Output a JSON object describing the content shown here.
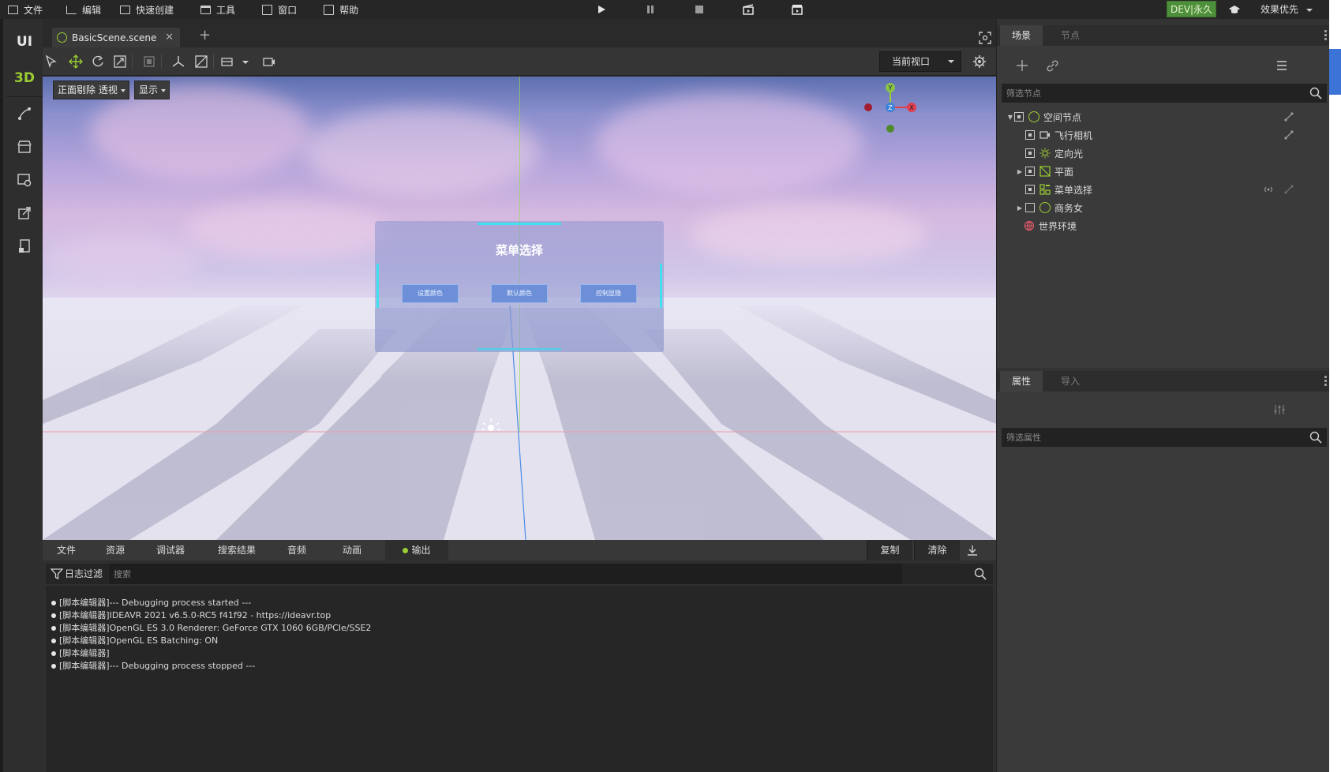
{
  "menubar": {
    "items": [
      {
        "label": "文件",
        "icon": "folder-icon"
      },
      {
        "label": "编辑",
        "icon": "crop-icon"
      },
      {
        "label": "快速创建",
        "icon": "edit-icon"
      },
      {
        "label": "工具",
        "icon": "window-icon"
      },
      {
        "label": "窗口",
        "icon": "frame-icon"
      },
      {
        "label": "帮助",
        "icon": "doc-icon"
      }
    ],
    "controls": [
      "play-icon",
      "pause-icon",
      "stop-icon",
      "clapper-open-icon",
      "clapper-icon"
    ],
    "dev_badge": "DEV|永久",
    "quality": "效果优先"
  },
  "leftrail": {
    "ui_label": "UI",
    "three_d_label": "3D",
    "icons": [
      "path-icon",
      "store-icon",
      "settings-panel-icon",
      "export-icon",
      "book-icon"
    ],
    "colors": {
      "ui": "#e6e6e6",
      "three_d": "#9acd32"
    }
  },
  "editor": {
    "tab_label": "BasicScene.scene",
    "viewport_select": "当前视口",
    "chips": {
      "cull": "正面剔除 透视",
      "display": "显示"
    },
    "scene_menu": {
      "title": "菜单选择",
      "buttons": [
        "设置颜色",
        "默认颜色",
        "控制显隐"
      ]
    },
    "gizmo": {
      "y": "Y",
      "z": "Z",
      "x": "X"
    }
  },
  "bottom": {
    "tabs": [
      "文件",
      "资源",
      "调试器",
      "搜索结果",
      "音频",
      "动画",
      "输出"
    ],
    "active_tab": "输出",
    "copy_label": "复制",
    "clear_label": "清除",
    "log_filter_label": "日志过滤",
    "search_placeholder": "搜索",
    "log_lines": [
      "[脚本编辑器]--- Debugging process started ---",
      "[脚本编辑器]IDEAVR 2021 v6.5.0-RC5 f41f92 - https://ideavr.top",
      "[脚本编辑器]OpenGL ES 3.0 Renderer: GeForce GTX 1060 6GB/PCIe/SSE2",
      "[脚本编辑器]OpenGL ES Batching: ON",
      "[脚本编辑器]",
      "[脚本编辑器]--- Debugging process stopped ---"
    ]
  },
  "right": {
    "scene_tab": "场景",
    "node_tab": "节点",
    "node_filter_placeholder": "筛选节点",
    "tree": [
      {
        "label": "空间节点",
        "icon": "spatial-node-icon",
        "level": 0,
        "expanded": true,
        "checked": true
      },
      {
        "label": "飞行相机",
        "icon": "camera-icon",
        "level": 1,
        "checked": true
      },
      {
        "label": "定向光",
        "icon": "sun-icon",
        "level": 1,
        "checked": true
      },
      {
        "label": "平面",
        "icon": "plane-icon",
        "level": 1,
        "collapsed": true,
        "checked": true
      },
      {
        "label": "菜单选择",
        "icon": "menu-grid-icon",
        "level": 1,
        "checked": true
      },
      {
        "label": "商务女",
        "icon": "spatial-node-icon",
        "level": 1,
        "collapsed": true,
        "checked": false
      },
      {
        "label": "世界环境",
        "icon": "globe-icon",
        "level": 0
      }
    ],
    "props_tab": "属性",
    "import_tab": "导入",
    "prop_filter_placeholder": "筛选属性"
  }
}
